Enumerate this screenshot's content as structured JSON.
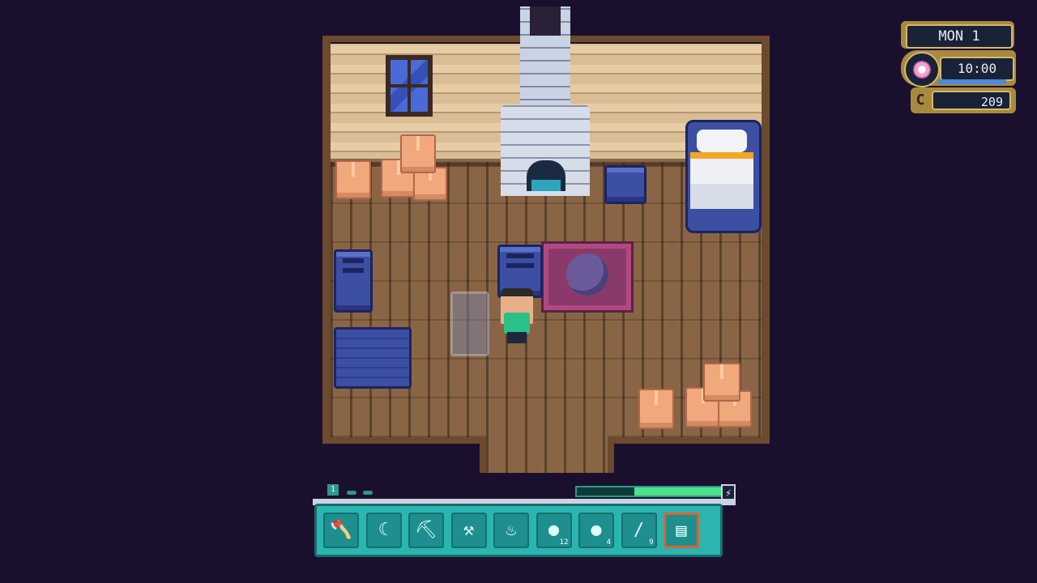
{
  "hud": {
    "day": "MON 1",
    "time": "10:00",
    "money": "209",
    "money_icon": "coin-icon",
    "clock_icon": "flower-clock-icon"
  },
  "hotbar": {
    "page": "1",
    "stamina_fraction": 0.6,
    "stamina_icon": "lightning-icon",
    "slots": [
      {
        "icon": "axe-icon",
        "glyph": "🪓",
        "count": ""
      },
      {
        "icon": "sickle-icon",
        "glyph": "☾",
        "count": ""
      },
      {
        "icon": "pickaxe-icon",
        "glyph": "⛏",
        "count": ""
      },
      {
        "icon": "hoe-icon",
        "glyph": "⚒",
        "count": ""
      },
      {
        "icon": "watering-can-icon",
        "glyph": "♨",
        "count": ""
      },
      {
        "icon": "seed-bag-red-icon",
        "glyph": "●",
        "count": "12"
      },
      {
        "icon": "seed-bag-yellow-icon",
        "glyph": "●",
        "count": "4"
      },
      {
        "icon": "fishing-rod-icon",
        "glyph": "∕",
        "count": "9"
      },
      {
        "icon": "chair-icon",
        "glyph": "▤",
        "count": ""
      }
    ],
    "selected_index": 8
  },
  "colors": {
    "background": "#1b0f2e",
    "hotbar": "#2bb5b0",
    "selected_slot": "#e0622e",
    "stamina": "#4fe08a",
    "hud_gold": "#a88a3c"
  }
}
